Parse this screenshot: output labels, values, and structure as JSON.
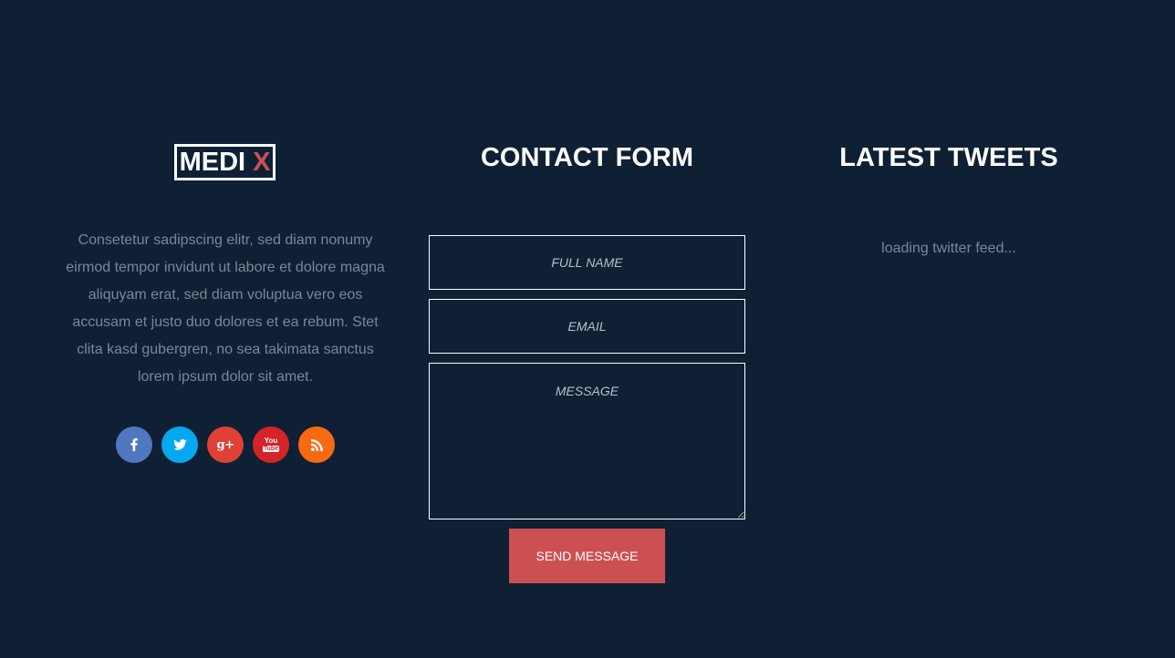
{
  "brand": {
    "logo_main": "MEDI",
    "logo_accent": "X",
    "accent_color": "#cc5052",
    "background_color": "#0f2035"
  },
  "about": {
    "text": "Consetetur sadipscing elitr, sed diam nonumy eirmod tempor invidunt ut labore et dolore magna aliquyam erat, sed diam voluptua vero eos accusam et justo duo dolores et ea rebum. Stet clita kasd gubergren, no sea takimata sanctus lorem ipsum dolor sit amet."
  },
  "socials": [
    {
      "name": "facebook",
      "icon": "facebook-icon",
      "color": "#4f78c0"
    },
    {
      "name": "twitter",
      "icon": "twitter-icon",
      "color": "#03a9ee"
    },
    {
      "name": "google-plus",
      "icon": "google-plus-icon",
      "color": "#de4136",
      "glyph": "g+"
    },
    {
      "name": "youtube",
      "icon": "youtube-icon",
      "color": "#d42428",
      "glyph_top": "You",
      "glyph_bottom": "Tube"
    },
    {
      "name": "rss",
      "icon": "rss-icon",
      "color": "#f76a12"
    }
  ],
  "contact": {
    "heading": "CONTACT FORM",
    "name_placeholder": "FULL NAME",
    "email_placeholder": "EMAIL",
    "message_placeholder": "MESSAGE",
    "submit_label": "SEND MESSAGE"
  },
  "tweets": {
    "heading": "LATEST TWEETS",
    "status": "loading twitter feed..."
  }
}
